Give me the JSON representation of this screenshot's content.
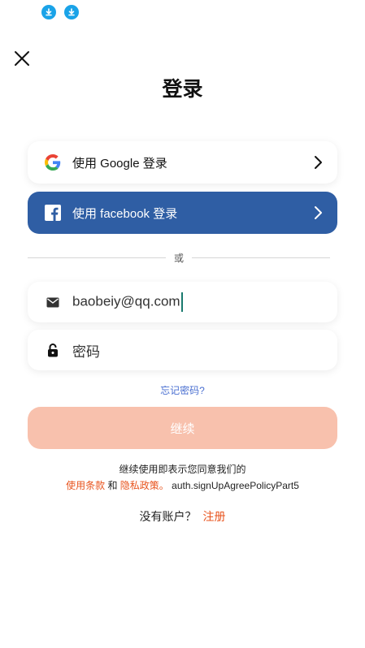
{
  "page": {
    "title": "登录"
  },
  "social": {
    "google_label": "使用 Google 登录",
    "facebook_label": "使用 facebook 登录"
  },
  "divider": {
    "or": "或"
  },
  "form": {
    "email_value": "baobeiy@qq.com",
    "password_placeholder": "密码",
    "forgot": "忘记密码?",
    "continue": "继续"
  },
  "policy": {
    "intro": "继续使用即表示您同意我们的",
    "terms": "使用条款",
    "and": "和",
    "privacy": "隐私政策。",
    "part5": "auth.signUpAgreePolicyPart5"
  },
  "signup": {
    "prompt": "没有账户？",
    "link": "注册"
  },
  "colors": {
    "facebook": "#2f5ea4",
    "accent": "#e8541e",
    "continue_bg": "#f8c1ad",
    "link_blue": "#4a6fd1"
  }
}
